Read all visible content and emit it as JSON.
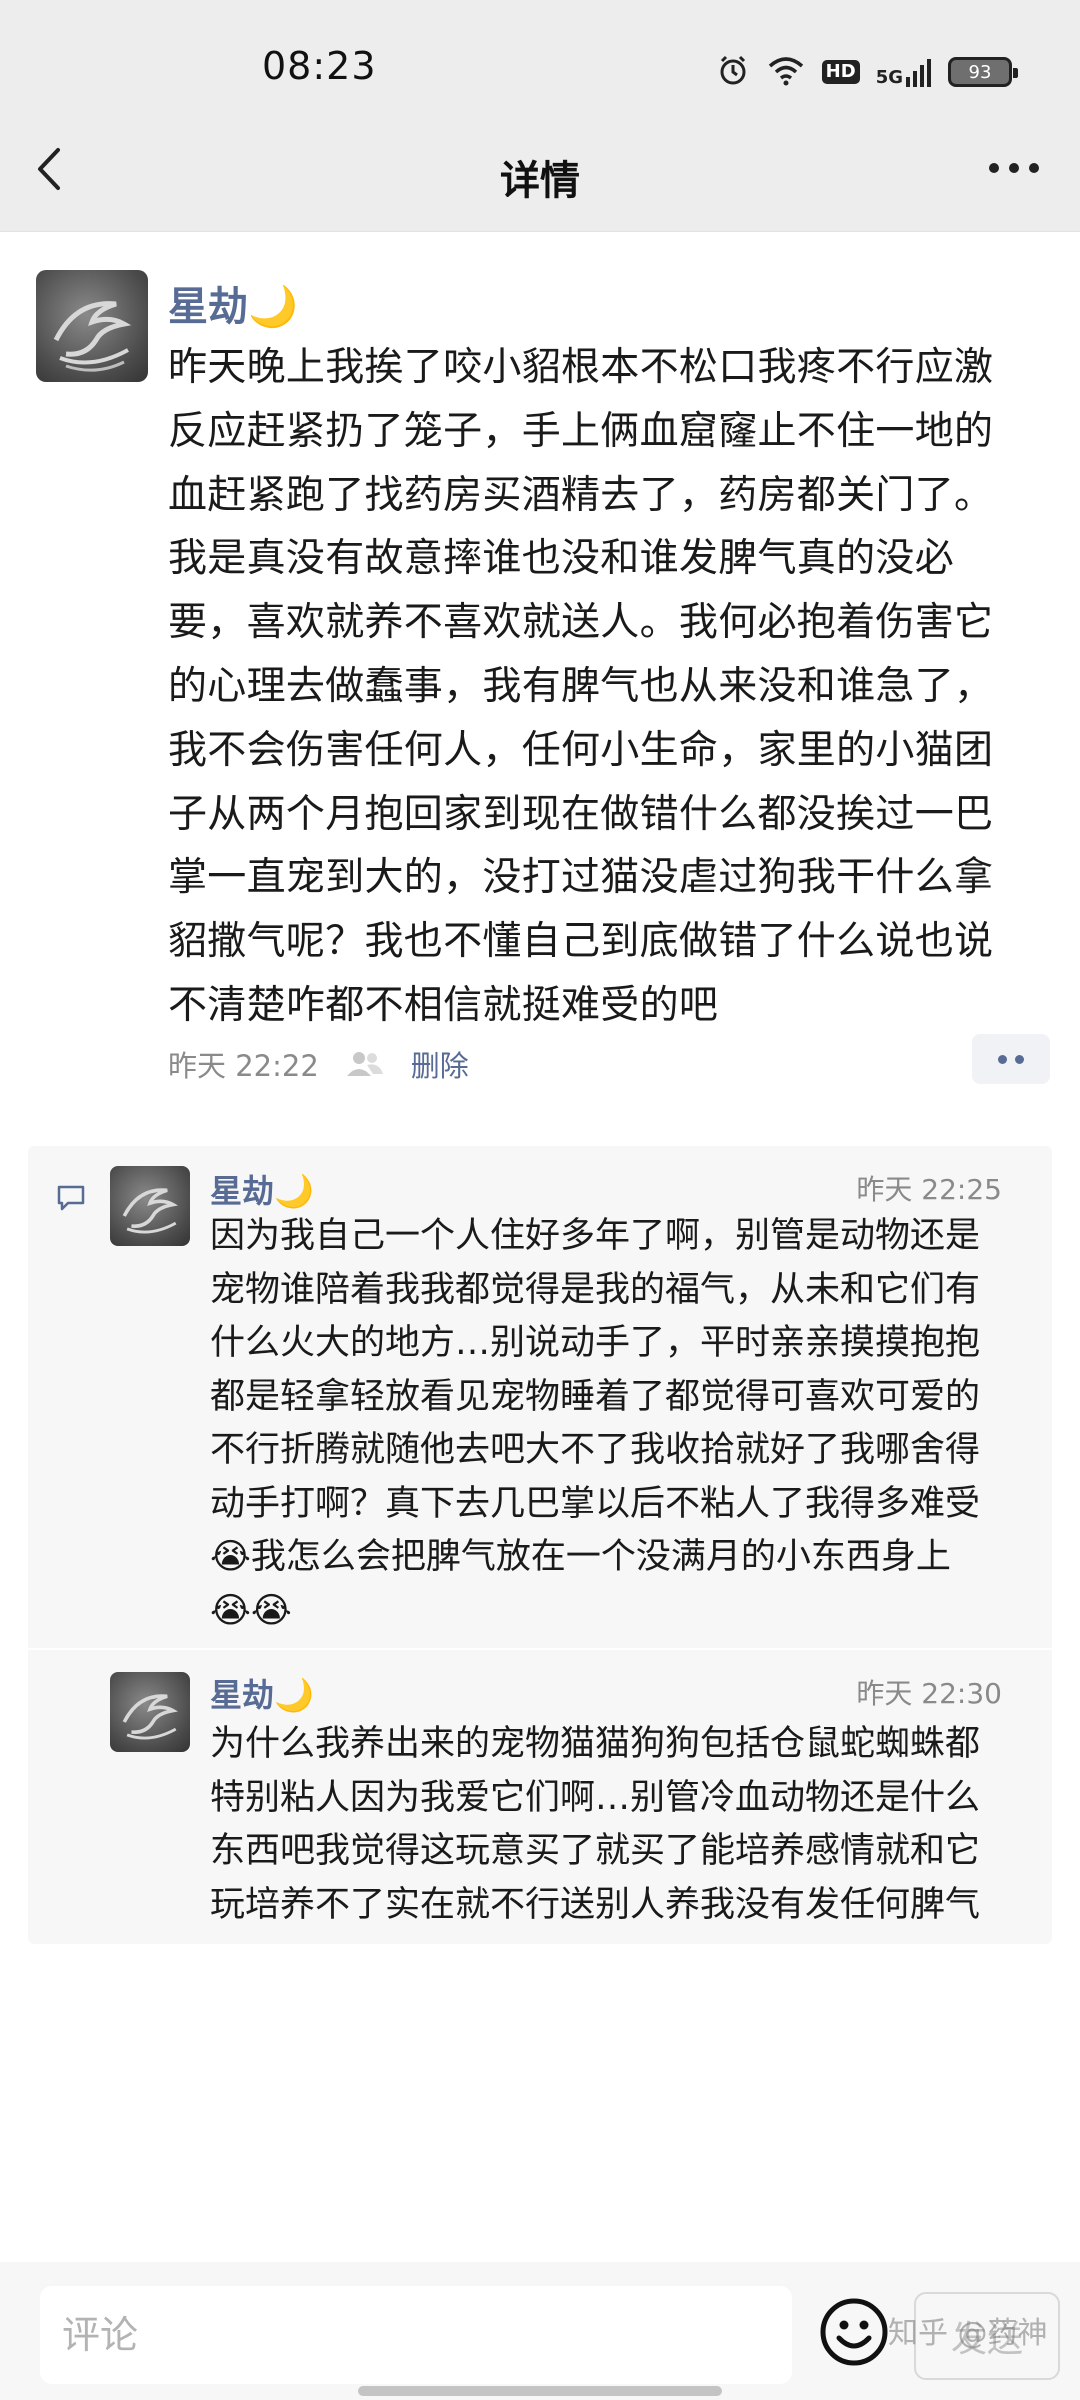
{
  "status_bar": {
    "time": "08:23",
    "network": "5G",
    "hd_label": "HD",
    "battery": "93",
    "icons": [
      "alarm-icon",
      "wifi-icon",
      "hd-icon",
      "signal-icon",
      "battery-icon"
    ]
  },
  "nav": {
    "title": "详情",
    "back_icon": "chevron-left-icon",
    "more_icon": "more-icon"
  },
  "post": {
    "author": "星劫🌙",
    "text": "昨天晚上我挨了咬小貂根本不松口我疼不行应激\n反应赶紧扔了笼子，手上俩血窟窿止不住一地的\n血赶紧跑了找药房买酒精去了，药房都关门了。\n我是真没有故意摔谁也没和谁发脾气真的没必\n要，喜欢就养不喜欢就送人。我何必抱着伤害它\n的心理去做蠢事，我有脾气也从来没和谁急了，\n我不会伤害任何人，任何小生命，家里的小猫团\n子从两个月抱回家到现在做错什么都没挨过一巴\n掌一直宠到大的，没打过猫没虐过狗我干什么拿\n貂撒气呢？我也不懂自己到底做错了什么说也说\n不清楚咋都不相信就挺难受的吧",
    "time": "昨天 22:22",
    "delete_label": "删除",
    "visibility_icon": "friends-icon"
  },
  "comments": [
    {
      "author": "星劫🌙",
      "time": "昨天 22:25",
      "text": "因为我自己一个人住好多年了啊，别管是动物还是\n宠物谁陪着我我都觉得是我的福气，从未和它们有\n什么火大的地方…别说动手了，平时亲亲摸摸抱抱\n都是轻拿轻放看见宠物睡着了都觉得可喜欢可爱的\n不行折腾就随他去吧大不了我收拾就好了我哪舍得\n动手打啊？真下去几巴掌以后不粘人了我得多难受\n😭我怎么会把脾气放在一个没满月的小东西身上\n😭😭"
    },
    {
      "author": "星劫🌙",
      "time": "昨天 22:30",
      "text": "为什么我养出来的宠物猫猫狗狗包括仓鼠蛇蜘蛛都\n特别粘人因为我爱它们啊…别管冷血动物还是什么\n东西吧我觉得这玩意买了就买了能培养感情就和它\n玩培养不了实在就不行送别人养我没有发任何脾气"
    }
  ],
  "comment_bar": {
    "placeholder": "评论",
    "send_label": "发送",
    "emoji_icon": "smiley-icon"
  },
  "watermark": "知乎 @药神"
}
